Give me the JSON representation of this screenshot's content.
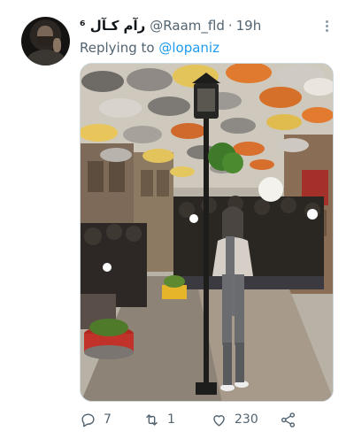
{
  "tweet": {
    "author": {
      "display_name": "رآم کـآل ⁶",
      "handle": "@Raam_fld"
    },
    "separator": "·",
    "time": "19h",
    "reply_prefix": "Replying to",
    "reply_to": "@lopaniz",
    "media": {
      "icon": "photo"
    },
    "actions": {
      "reply_count": "7",
      "retweet_count": "1",
      "like_count": "230",
      "share_icon": "share-icon"
    }
  },
  "colors": {
    "link": "#1d9bf0",
    "secondary_text": "#536471",
    "primary_text": "#0f1419"
  }
}
